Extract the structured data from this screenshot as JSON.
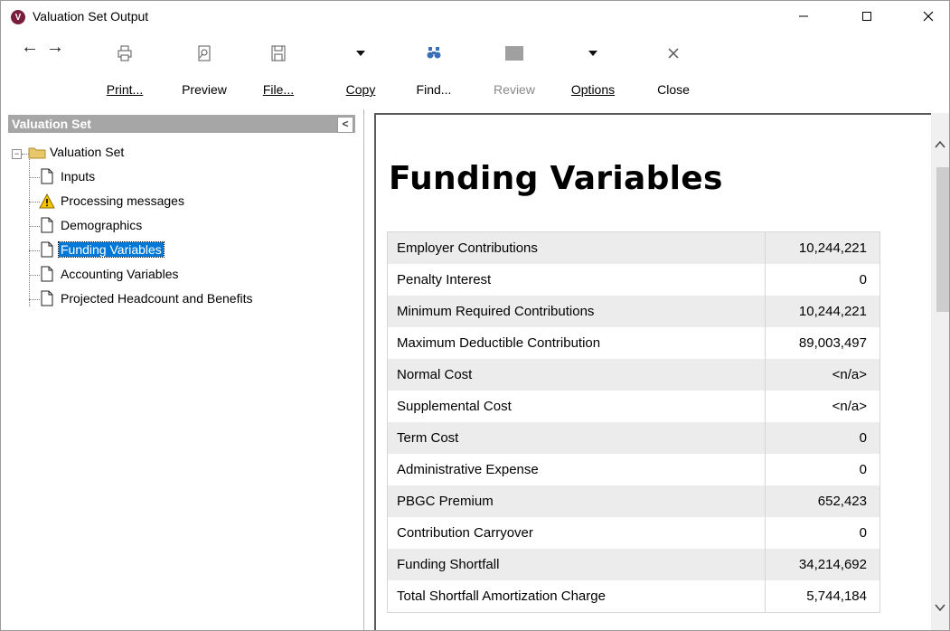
{
  "window": {
    "title": "Valuation Set Output",
    "app_icon_letter": "V"
  },
  "toolbar": {
    "print_label": "Print...",
    "preview_label": "Preview",
    "file_label": "File...",
    "copy_label": "Copy",
    "find_label": "Find...",
    "review_label": "Review",
    "options_label": "Options",
    "close_label": "Close"
  },
  "sidebar": {
    "header": "Valuation Set",
    "collapse_glyph": "<",
    "root_label": "Valuation Set",
    "items": [
      {
        "label": "Inputs",
        "icon": "document-icon"
      },
      {
        "label": "Processing messages",
        "icon": "warning-icon"
      },
      {
        "label": "Demographics",
        "icon": "document-icon"
      },
      {
        "label": "Funding Variables",
        "icon": "document-icon",
        "selected": true
      },
      {
        "label": "Accounting Variables",
        "icon": "document-icon"
      },
      {
        "label": "Projected Headcount and Benefits",
        "icon": "document-icon"
      }
    ]
  },
  "report": {
    "heading": "Funding Variables",
    "rows": [
      {
        "label": "Employer Contributions",
        "value": "10,244,221"
      },
      {
        "label": "Penalty Interest",
        "value": "0"
      },
      {
        "label": "Minimum Required Contributions",
        "value": "10,244,221"
      },
      {
        "label": "Maximum Deductible Contribution",
        "value": "89,003,497"
      },
      {
        "label": "Normal Cost",
        "value": "<n/a>"
      },
      {
        "label": "Supplemental Cost",
        "value": "<n/a>"
      },
      {
        "label": "Term Cost",
        "value": "0"
      },
      {
        "label": "Administrative Expense",
        "value": "0"
      },
      {
        "label": "PBGC Premium",
        "value": "652,423"
      },
      {
        "label": "Contribution Carryover",
        "value": "0"
      },
      {
        "label": "Funding Shortfall",
        "value": "34,214,692"
      },
      {
        "label": "Total Shortfall Amortization Charge",
        "value": "5,744,184"
      }
    ]
  },
  "colors": {
    "selection": "#0078d7",
    "pane_header": "#a6a6a6",
    "app_icon": "#7a1d3c",
    "folder": "#e8c66a",
    "warning": "#f5c400"
  }
}
